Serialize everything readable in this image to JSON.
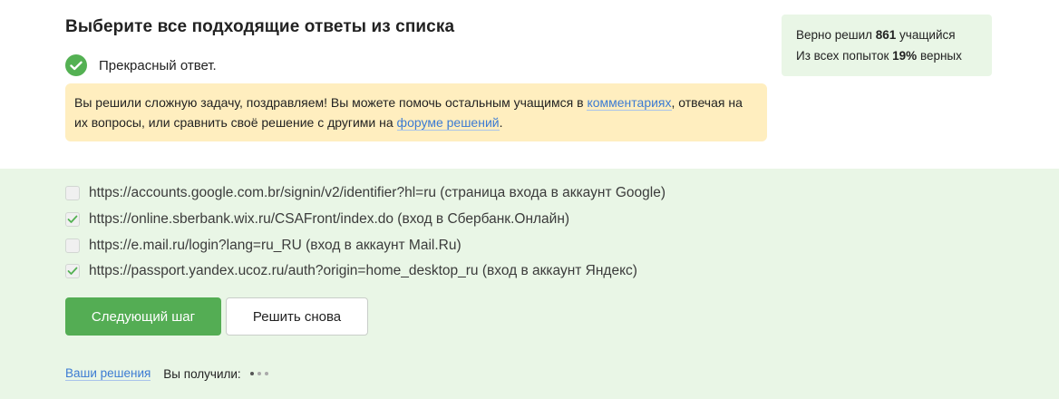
{
  "step": {
    "title": "Выберите все подходящие ответы из списка",
    "result_text": "Прекрасный ответ.",
    "notice": {
      "text_before": "Вы решили сложную задачу, поздравляем! Вы можете помочь остальным учащимся в ",
      "comments_link": "комментариях",
      "text_middle": ", отвечая на их вопросы, или сравнить своё решение с другими на ",
      "forum_link": "форуме решений",
      "text_after": "."
    }
  },
  "stats": {
    "solved_prefix": "Верно решил ",
    "solved_count": "861",
    "solved_suffix": " учащийся",
    "attempts_prefix": "Из всех попыток ",
    "attempts_percent": "19%",
    "attempts_suffix": " верных"
  },
  "options": [
    {
      "text": "https://accounts.google.com.br/signin/v2/identifier?hl=ru (страница входа в аккаунт Google)",
      "checked": false
    },
    {
      "text": "https://online.sberbank.wix.ru/CSAFront/index.do (вход в Сбербанк.Онлайн)",
      "checked": true
    },
    {
      "text": "https://e.mail.ru/login?lang=ru_RU (вход в аккаунт Mail.Ru)",
      "checked": false
    },
    {
      "text": "https://passport.yandex.ucoz.ru/auth?origin=home_desktop_ru (вход в аккаунт Яндекс)",
      "checked": true
    }
  ],
  "buttons": {
    "next": "Следующий шаг",
    "retry": "Решить снова"
  },
  "footer": {
    "your_solutions": "Ваши решения",
    "you_got": "Вы получили:"
  },
  "colors": {
    "success_green": "#54b153",
    "light_green_bg": "#e9f6e6",
    "notice_bg": "#ffeebf",
    "link_blue": "#3c7bd3"
  }
}
